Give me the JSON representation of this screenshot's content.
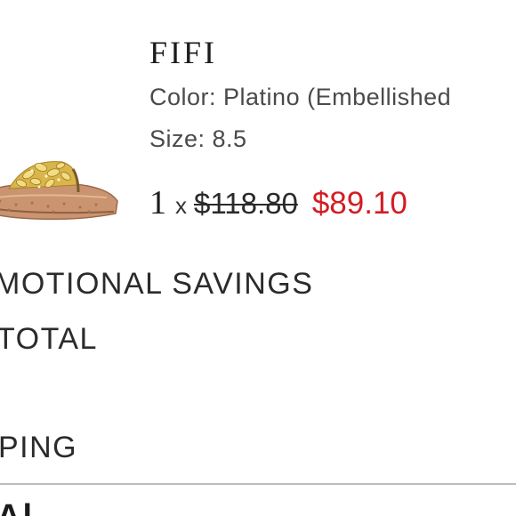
{
  "product": {
    "name": "FIFI",
    "color_line": "Color: Platino (Embellished",
    "size_line": "Size: 8.5",
    "quantity": "1",
    "times": "x",
    "original_price": "$118.80",
    "sale_price": "$89.10",
    "image_icon": "sandal-product-image"
  },
  "summary": {
    "promotional_savings_label": "MOTIONAL SAVINGS",
    "subtotal_label": "TOTAL",
    "shipping_label": "PING",
    "bottom_fragment": "Al"
  },
  "colors": {
    "sale_price": "#d21d23",
    "text": "#2a2a2a",
    "divider": "#bdbdbd"
  }
}
